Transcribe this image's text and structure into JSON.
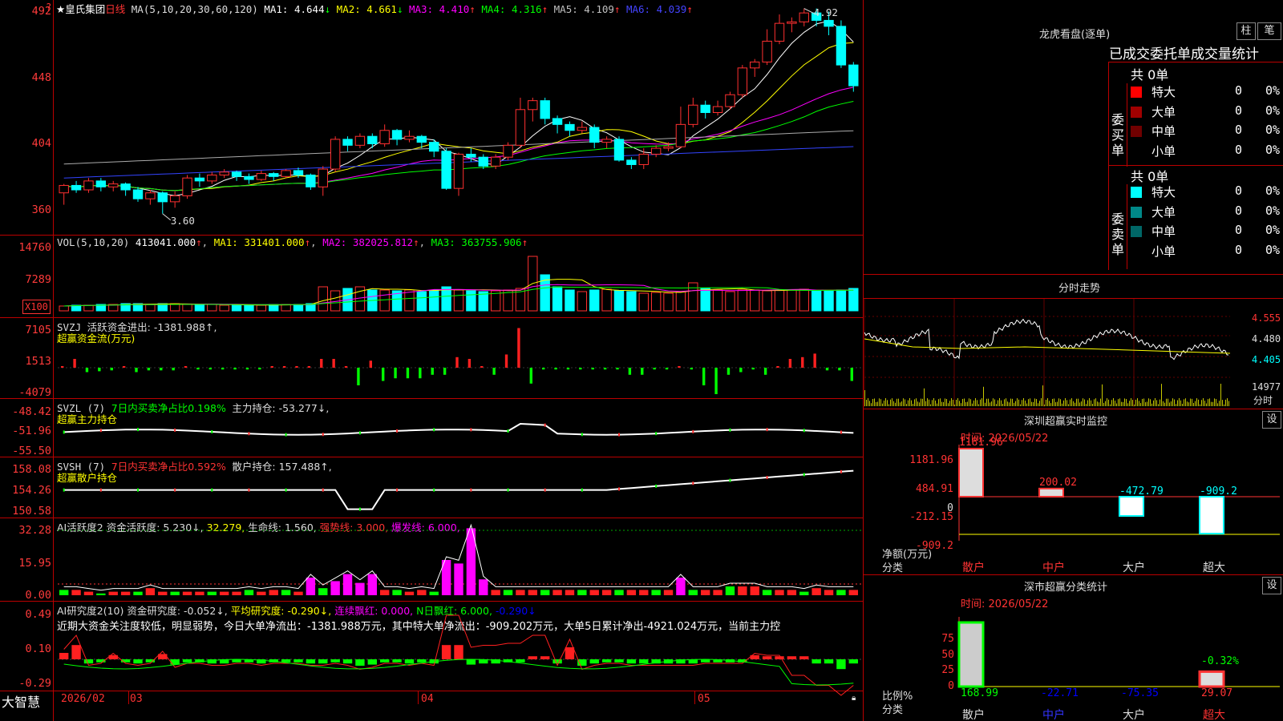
{
  "stock_name": "★皇氏集团",
  "period": "日线",
  "header_question": "?",
  "ma_line": {
    "label": "MA(5,10,20,30,60,120)",
    "items": [
      {
        "name": "MA1:",
        "value": "4.644",
        "arrow": "↓",
        "color": "#ffffff"
      },
      {
        "name": "MA2:",
        "value": "4.661",
        "arrow": "↓",
        "color": "#ffff00"
      },
      {
        "name": "MA3:",
        "value": "4.410",
        "arrow": "↑",
        "color": "#ff00ff"
      },
      {
        "name": "MA4:",
        "value": "4.316",
        "arrow": "↑",
        "color": "#00ff00"
      },
      {
        "name": "MA5:",
        "value": "4.109",
        "arrow": "↑",
        "color": "#c0c0c0"
      },
      {
        "name": "MA6:",
        "value": "4.039",
        "arrow": "↑",
        "color": "#4444ff"
      }
    ]
  },
  "price_axis": [
    "492",
    "448",
    "404",
    "360"
  ],
  "price_high_label": "4.92",
  "price_low_label": "3.60",
  "vol": {
    "title": "VOL(5,10,20)",
    "value": "413041.000",
    "v_arrow": "↑",
    "ma1": "MA1: 331401.000",
    "ma1_arrow": "↑",
    "ma2": "MA2: 382025.812",
    "ma2_arrow": "↑",
    "ma3": "MA3: 363755.906",
    "ma3_arrow": "↑",
    "axis": [
      "14760",
      "7289",
      "X100"
    ]
  },
  "svzj": {
    "title": "SVZJ",
    "label": "活跃资金进出: -1381.988↑,",
    "sub": "超赢资金流(万元)",
    "axis": [
      "7105",
      "1513",
      "-4079"
    ]
  },
  "svzl": {
    "title": "SVZL (7)",
    "highlight": "7日内买卖净占比0.198%",
    "label": "主力持仓: -53.277↓,",
    "sub": "超赢主力持仓",
    "axis": [
      "-48.42",
      "-51.96",
      "-55.50"
    ]
  },
  "svsh": {
    "title": "SVSH (7)",
    "highlight": "7日内买卖净占比0.592%",
    "label": "散户持仓: 157.488↑,",
    "sub": "超赢散户持仓",
    "axis": [
      "158.08",
      "154.26",
      "150.58"
    ]
  },
  "ai2": {
    "title": "AI活跃度2",
    "l1": "资金活跃度: 5.230↓,",
    "l2": "32.279,",
    "l3": "生命线: 1.560,",
    "l4": "强势线: 3.000,",
    "l5": "爆发线: 6.000,",
    "axis": [
      "32.28",
      "15.95",
      "0.00"
    ]
  },
  "ai_research": {
    "title": "AI研究度2(10)",
    "l1": "资金研究度: -0.052↓,",
    "l2": "平均研究度: -0.290↓,",
    "l3": "连续飘红: 0.000,",
    "l4": "N日飘红: 6.000,",
    "l5": "-0.290↓",
    "axis": [
      "0.49",
      "0.10",
      "-0.29"
    ],
    "desc": "近期大资金关注度较低，明显弱势，今日大单净流出：-1381.988万元，其中特大单净流出：-909.202万元，大单5日累计净出-4921.024万元，当前主力控"
  },
  "date_axis": {
    "brand": "大智慧",
    "labels": [
      "2026/02",
      "03",
      "04",
      "05"
    ]
  },
  "dragon": {
    "title": "龙虎看盘(逐单)",
    "btn1": "柱",
    "btn2": "笔",
    "tabs": [
      "已成交",
      "委托单",
      "成交量统计"
    ],
    "buy": {
      "side": "委买单",
      "total": "共 0单",
      "rows": [
        {
          "label": "特大",
          "n": "0",
          "pct": "0%",
          "color": "#ff0000"
        },
        {
          "label": "大单",
          "n": "0",
          "pct": "0%",
          "color": "#a00000"
        },
        {
          "label": "中单",
          "n": "0",
          "pct": "0%",
          "color": "#700000"
        },
        {
          "label": "小单",
          "n": "0",
          "pct": "0%",
          "color": ""
        }
      ]
    },
    "sell": {
      "side": "委卖单",
      "total": "共 0单",
      "rows": [
        {
          "label": "特大",
          "n": "0",
          "pct": "0%",
          "color": "#00ffff"
        },
        {
          "label": "大单",
          "n": "0",
          "pct": "0%",
          "color": "#008888"
        },
        {
          "label": "中单",
          "n": "0",
          "pct": "0%",
          "color": "#006666"
        },
        {
          "label": "小单",
          "n": "0",
          "pct": "0%",
          "color": ""
        }
      ]
    }
  },
  "intraday": {
    "title": "分时走势",
    "axis": [
      "4.555",
      "4.480",
      "4.405",
      "14977",
      "分时"
    ]
  },
  "sz_monitor": {
    "title": "深圳超赢实时监控",
    "btn": "设",
    "time": "时间: 2026/05/22",
    "axis": [
      "1181.96",
      "484.91",
      "0",
      "-212.15",
      "-909.2"
    ],
    "ylabel": "净额(万元)",
    "xlabel": "分类",
    "bars": [
      {
        "cat": "散户",
        "value": "1181.96"
      },
      {
        "cat": "中户",
        "value": "200.02"
      },
      {
        "cat": "大户",
        "value": "-472.79"
      },
      {
        "cat": "超大",
        "value": "-909.2"
      }
    ]
  },
  "sz_class": {
    "title": "深市超赢分类统计",
    "btn": "设",
    "time": "时间: 2026/05/22",
    "axis": [
      "75",
      "50",
      "25",
      "0"
    ],
    "ylabel": "比例%",
    "xlabel": "分类",
    "bars": [
      {
        "cat": "散户",
        "value": "168.99",
        "pct": ""
      },
      {
        "cat": "中户",
        "value": "-22.71",
        "pct": ""
      },
      {
        "cat": "大户",
        "value": "-75.35",
        "pct": ""
      },
      {
        "cat": "超大",
        "value": "29.07",
        "pct": "-0.32%"
      }
    ]
  },
  "chart_data": {
    "type": "candlestick",
    "dates_shown": [
      "2026/02",
      "03",
      "04",
      "05"
    ],
    "price_range": [
      3.6,
      4.92
    ],
    "candles": [
      [
        3.72,
        3.77,
        3.64,
        3.78
      ],
      [
        3.77,
        3.74,
        3.72,
        3.8
      ],
      [
        3.74,
        3.8,
        3.72,
        3.82
      ],
      [
        3.8,
        3.76,
        3.73,
        3.82
      ],
      [
        3.76,
        3.78,
        3.73,
        3.8
      ],
      [
        3.78,
        3.74,
        3.7,
        3.79
      ],
      [
        3.74,
        3.68,
        3.66,
        3.76
      ],
      [
        3.68,
        3.72,
        3.64,
        3.74
      ],
      [
        3.72,
        3.66,
        3.58,
        3.73
      ],
      [
        3.66,
        3.7,
        3.62,
        3.73
      ],
      [
        3.7,
        3.82,
        3.68,
        3.84
      ],
      [
        3.82,
        3.8,
        3.76,
        3.85
      ],
      [
        3.8,
        3.84,
        3.78,
        3.86
      ],
      [
        3.84,
        3.86,
        3.82,
        3.88
      ],
      [
        3.86,
        3.83,
        3.8,
        3.87
      ],
      [
        3.83,
        3.81,
        3.78,
        3.85
      ],
      [
        3.81,
        3.85,
        3.8,
        3.87
      ],
      [
        3.85,
        3.83,
        3.8,
        3.86
      ],
      [
        3.83,
        3.87,
        3.82,
        3.88
      ],
      [
        3.87,
        3.84,
        3.82,
        3.89
      ],
      [
        3.84,
        3.76,
        3.74,
        3.85
      ],
      [
        3.76,
        3.88,
        3.7,
        3.9
      ],
      [
        3.88,
        4.08,
        3.86,
        4.1
      ],
      [
        4.08,
        4.04,
        4.0,
        4.1
      ],
      [
        4.04,
        4.1,
        4.02,
        4.12
      ],
      [
        4.1,
        4.05,
        4.02,
        4.12
      ],
      [
        4.05,
        4.14,
        4.03,
        4.18
      ],
      [
        4.14,
        4.08,
        4.04,
        4.15
      ],
      [
        4.08,
        4.1,
        4.06,
        4.14
      ],
      [
        4.1,
        4.06,
        4.02,
        4.11
      ],
      [
        4.06,
        4.0,
        3.96,
        4.08
      ],
      [
        4.0,
        3.75,
        3.74,
        4.02
      ],
      [
        3.75,
        3.98,
        3.7,
        3.99
      ],
      [
        3.98,
        3.96,
        3.93,
        4.02
      ],
      [
        3.96,
        3.9,
        3.88,
        3.98
      ],
      [
        3.9,
        3.96,
        3.88,
        3.98
      ],
      [
        3.96,
        4.04,
        3.94,
        4.06
      ],
      [
        4.04,
        4.28,
        4.02,
        4.36
      ],
      [
        4.28,
        4.34,
        4.2,
        4.36
      ],
      [
        4.34,
        4.22,
        4.18,
        4.36
      ],
      [
        4.22,
        4.18,
        4.12,
        4.24
      ],
      [
        4.18,
        4.14,
        4.1,
        4.2
      ],
      [
        4.14,
        4.16,
        4.12,
        4.2
      ],
      [
        4.16,
        4.06,
        4.02,
        4.18
      ],
      [
        4.06,
        4.08,
        4.02,
        4.1
      ],
      [
        4.08,
        3.94,
        3.93,
        4.1
      ],
      [
        3.94,
        3.91,
        3.88,
        3.96
      ],
      [
        3.91,
        3.98,
        3.88,
        4.02
      ],
      [
        3.98,
        4.02,
        3.96,
        4.04
      ],
      [
        4.02,
        4.03,
        4.0,
        4.06
      ],
      [
        4.03,
        4.18,
        4.02,
        4.3
      ],
      [
        4.18,
        4.31,
        4.16,
        4.36
      ],
      [
        4.31,
        4.26,
        4.22,
        4.34
      ],
      [
        4.26,
        4.3,
        4.24,
        4.34
      ],
      [
        4.3,
        4.38,
        4.28,
        4.4
      ],
      [
        4.38,
        4.56,
        4.36,
        4.58
      ],
      [
        4.56,
        4.6,
        4.5,
        4.62
      ],
      [
        4.6,
        4.74,
        4.58,
        4.82
      ],
      [
        4.74,
        4.86,
        4.72,
        4.92
      ],
      [
        4.86,
        4.87,
        4.8,
        4.9
      ],
      [
        4.87,
        4.93,
        4.84,
        4.96
      ],
      [
        4.93,
        4.88,
        4.84,
        4.96
      ],
      [
        4.88,
        4.84,
        4.78,
        4.94
      ],
      [
        4.84,
        4.58,
        4.56,
        4.88
      ],
      [
        4.58,
        4.44,
        4.4,
        4.6
      ]
    ]
  }
}
